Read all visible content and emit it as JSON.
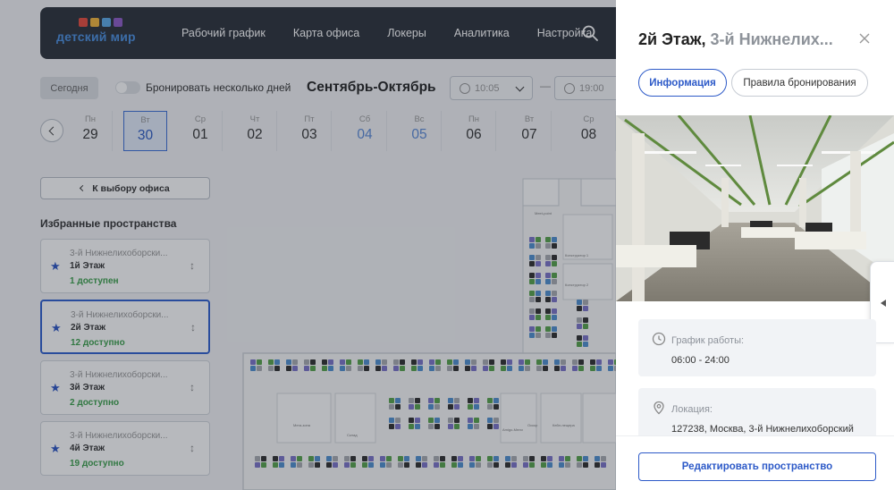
{
  "header": {
    "logo_text": "детский мир",
    "logo_colors": [
      "#e84a3b",
      "#f4b63a",
      "#5aa9e6",
      "#8e5bc8"
    ],
    "nav": [
      "Рабочий график",
      "Карта офиса",
      "Локеры",
      "Аналитика",
      "Настройка"
    ]
  },
  "toolbar": {
    "today": "Сегодня",
    "multi_days": "Бронировать несколько дней",
    "month": "Сентябрь-Октябрь",
    "time_from": "10:05",
    "time_to": "19:00",
    "dash": "—"
  },
  "days": [
    {
      "dow": "Пн",
      "num": "29"
    },
    {
      "dow": "Вт",
      "num": "30"
    },
    {
      "dow": "Ср",
      "num": "01"
    },
    {
      "dow": "Чт",
      "num": "02"
    },
    {
      "dow": "Пт",
      "num": "03"
    },
    {
      "dow": "Сб",
      "num": "04"
    },
    {
      "dow": "Вс",
      "num": "05"
    },
    {
      "dow": "Пн",
      "num": "06"
    },
    {
      "dow": "Вт",
      "num": "07"
    },
    {
      "dow": "Ср",
      "num": "08"
    }
  ],
  "left": {
    "back": "К выбору офиса",
    "favorites_title": "Избранные пространства",
    "favorites": [
      {
        "addr": "3-й Нижнелихоборски...",
        "floor": "1й Этаж",
        "avail": "1 доступен"
      },
      {
        "addr": "3-й Нижнелихоборски...",
        "floor": "2й Этаж",
        "avail": "12 доступно"
      },
      {
        "addr": "3-й Нижнелихоборски...",
        "floor": "3й Этаж",
        "avail": "2 доступно"
      },
      {
        "addr": "3-й Нижнелихоборски...",
        "floor": "4й Этаж",
        "avail": "19 доступно"
      }
    ]
  },
  "map": {
    "labels": [
      "Конструктор 1",
      "Конструктор 2",
      "Meet-point",
      "Мега-зона",
      "Склад",
      "Amigo-Мели",
      "Оскор",
      "Кейл-пещера"
    ]
  },
  "panel": {
    "title_main": "2й Этаж,",
    "title_sub": "3-й Нижнелих...",
    "tab_info": "Информация",
    "tab_rules": "Правила бронирования",
    "schedule_label": "График работы:",
    "schedule_value": "06:00 - 24:00",
    "location_label": "Локация:",
    "location_value": "127238, Москва, 3-й Нижнелихоборский",
    "edit_button": "Редактировать пространство",
    "accent": "#2d5ac8"
  }
}
